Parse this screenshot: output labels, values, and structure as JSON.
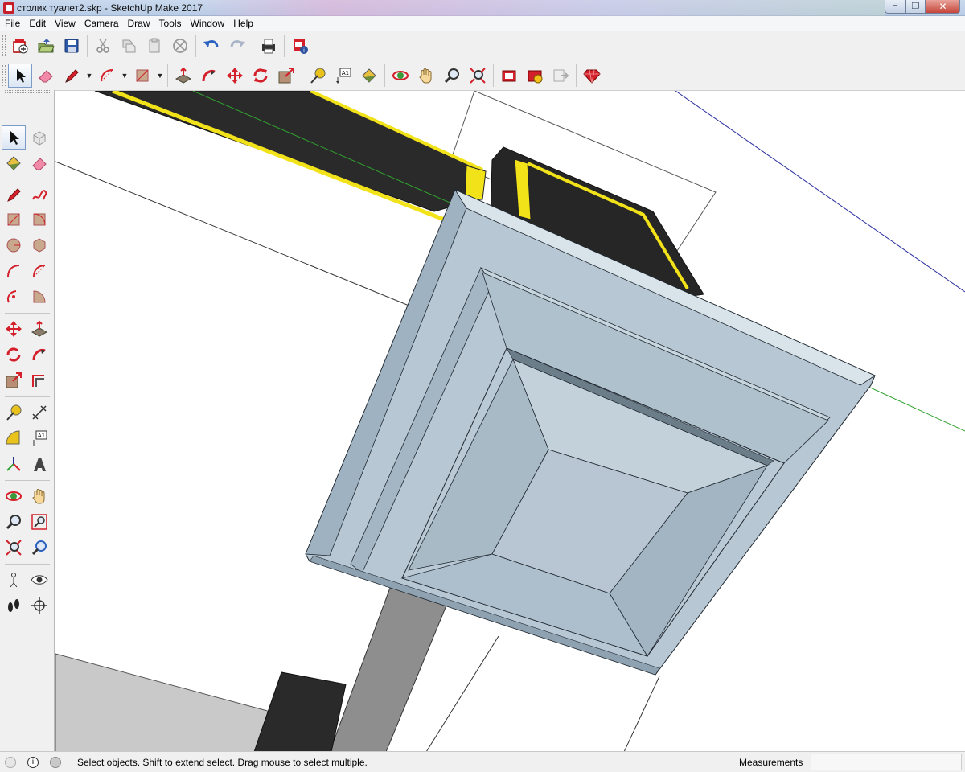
{
  "window": {
    "title": "столик туалет2.skp - SketchUp Make 2017",
    "controls": {
      "minimize": "‒",
      "maximize": "❐",
      "close": "✕"
    }
  },
  "menu": [
    "File",
    "Edit",
    "View",
    "Camera",
    "Draw",
    "Tools",
    "Window",
    "Help"
  ],
  "toolbar_standard": [
    {
      "name": "new",
      "icon": "new-file-icon"
    },
    {
      "name": "open",
      "icon": "open-folder-icon"
    },
    {
      "name": "save",
      "icon": "save-disk-icon"
    },
    {
      "name": "cut",
      "icon": "scissors-icon"
    },
    {
      "name": "copy",
      "icon": "copy-icon"
    },
    {
      "name": "paste",
      "icon": "paste-icon"
    },
    {
      "name": "erase",
      "icon": "erase-circle-icon"
    },
    {
      "name": "undo",
      "icon": "undo-arrow-icon"
    },
    {
      "name": "redo",
      "icon": "redo-arrow-icon"
    },
    {
      "name": "print",
      "icon": "printer-icon"
    },
    {
      "name": "model-info",
      "icon": "model-info-icon"
    }
  ],
  "toolbar_getting_started": [
    "select-arrow-icon",
    "eraser-icon",
    "pencil-icon",
    "arc-icon",
    "rectangle-icon",
    "push-pull-icon",
    "follow-me-icon",
    "move-icon",
    "rotate-icon",
    "scale-icon",
    "tape-measure-icon",
    "text-icon",
    "paint-bucket-icon",
    "orbit-icon",
    "pan-hand-icon",
    "zoom-icon",
    "zoom-extents-icon",
    "3d-warehouse-icon",
    "extension-warehouse-icon",
    "send-to-layout-icon",
    "extension-ruby-icon"
  ],
  "palette": [
    [
      "select-arrow-icon",
      "make-component-icon"
    ],
    [
      "paint-bucket-icon",
      "eraser-icon"
    ],
    [
      "line-pencil-icon",
      "freehand-icon"
    ],
    [
      "rectangle-icon",
      "rotated-rectangle-icon"
    ],
    [
      "circle-icon",
      "polygon-icon"
    ],
    [
      "arc-icon",
      "two-point-arc-icon"
    ],
    [
      "three-point-arc-icon",
      "pie-icon"
    ],
    [
      "move-icon",
      "push-pull-icon"
    ],
    [
      "rotate-icon",
      "follow-me-icon"
    ],
    [
      "scale-icon",
      "offset-icon"
    ],
    [
      "tape-measure-icon",
      "dimension-icon"
    ],
    [
      "protractor-icon",
      "text-icon"
    ],
    [
      "axes-icon",
      "3d-text-icon"
    ],
    [
      "orbit-icon",
      "pan-icon"
    ],
    [
      "zoom-icon",
      "zoom-window-icon"
    ],
    [
      "zoom-extents-icon",
      "previous-view-icon"
    ],
    [
      "position-camera-icon",
      "look-around-icon"
    ],
    [
      "walk-icon",
      "section-plane-icon"
    ]
  ],
  "status": {
    "message": "Select objects. Shift to extend select. Drag mouse to select multiple.",
    "measurements_label": "Measurements",
    "measurements_value": ""
  },
  "colors": {
    "accent_red": "#d3202a",
    "model_face": "#b7c7d3",
    "stripe_yellow": "#f2e21a",
    "dark_face": "#2a2a2a",
    "axis_green": "#2fa32f",
    "axis_blue": "#2a2fa0"
  }
}
